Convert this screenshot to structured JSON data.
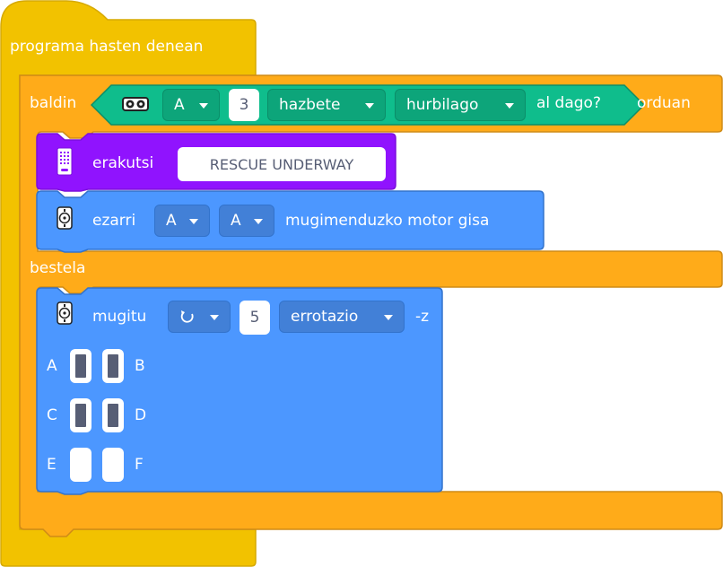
{
  "colors": {
    "hat_yellow": "#f2c200",
    "hat_stroke": "#d6a900",
    "control_orange": "#ffab19",
    "control_stroke": "#cf8b17",
    "display_purple": "#9013fe",
    "display_stroke": "#7b10dc",
    "motor_blue": "#4c97ff",
    "motor_stroke": "#3373cc",
    "sensor_teal": "#0fbd8c",
    "sensor_stroke": "#0b8e69"
  },
  "hat": {
    "label": "programa hasten denean"
  },
  "if_block": {
    "if_label": "baldin",
    "then_label": "orduan",
    "else_label": "bestela",
    "condition": {
      "sensor_icon": "distance-sensor-icon",
      "port_value": "A",
      "number_value": "3",
      "unit_value": "hazbete",
      "comparison_value": "hurbilago",
      "suffix": "al dago?"
    }
  },
  "display_block": {
    "icon": "light-matrix-icon",
    "label": "erakutsi",
    "text_value": "RESCUE UNDERWAY"
  },
  "motor_pair_block": {
    "icon": "motor-icon",
    "label": "ezarri",
    "port_left": "A",
    "port_right": "A",
    "suffix": "mugimenduzko motor gisa"
  },
  "motor_run_block": {
    "icon": "motor-icon",
    "label": "mugitu",
    "direction_icon": "rotate-counterclockwise-icon",
    "number_value": "5",
    "unit_value": "errotazio",
    "suffix": "-z",
    "ports": [
      {
        "left": "A",
        "right": "B",
        "left_on": true,
        "right_on": true
      },
      {
        "left": "C",
        "right": "D",
        "left_on": true,
        "right_on": true
      },
      {
        "left": "E",
        "right": "F",
        "left_on": false,
        "right_on": false
      }
    ]
  }
}
